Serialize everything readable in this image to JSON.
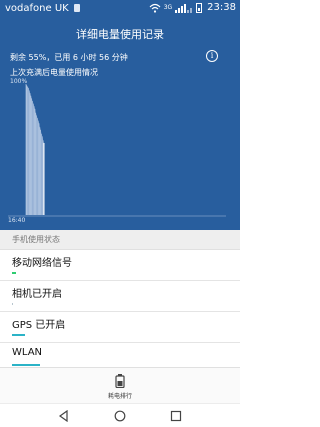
{
  "status_bar": {
    "carrier": "vodafone UK",
    "network_type": "3G",
    "time": "23:38"
  },
  "header": {
    "title": "详细电量使用记录",
    "remaining": "剩余 55%，已用 6 小时 56 分钟",
    "subtitle": "上次充满后电量使用情况",
    "info_label": "i"
  },
  "chart_data": {
    "type": "area",
    "y_top_label": "100%",
    "x_start_label": "16:40",
    "note": "battery level history since last full charge",
    "x": [
      0,
      1,
      2,
      3,
      4,
      5,
      6,
      7,
      8,
      9,
      10,
      11,
      12,
      13,
      14,
      15,
      16,
      17,
      18,
      19,
      20,
      21,
      22
    ],
    "values": [
      100,
      99,
      98,
      97,
      95,
      93,
      91,
      89,
      87,
      85,
      83,
      81,
      78,
      76,
      74,
      72,
      70,
      67,
      65,
      62,
      60,
      57,
      55
    ],
    "ylim": [
      0,
      100
    ]
  },
  "section": {
    "title": "手机使用状态"
  },
  "list": [
    {
      "label": "移动网络信号",
      "bar_color": "#2ecc71",
      "fill": 0.02
    },
    {
      "label": "相机已开启",
      "bar_color": "#b8c6cf",
      "fill": 0.005
    },
    {
      "label": "GPS 已开启",
      "bar_color": "#2bb3c7",
      "fill": 0.06
    },
    {
      "label": "WLAN",
      "bar_color": "#2bb3c7",
      "fill": 0.13
    }
  ],
  "bottom_tab": {
    "label": "耗电排行",
    "icon": "battery-icon"
  },
  "nav": {
    "back": "back-icon",
    "home": "home-icon",
    "recents": "recents-icon"
  }
}
